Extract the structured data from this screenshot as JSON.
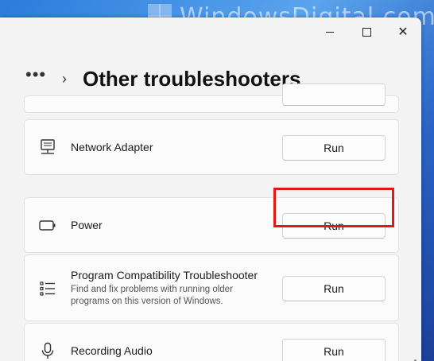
{
  "watermark": {
    "text": "WindowsDigital.com"
  },
  "window": {
    "caption": {
      "minimize_icon": "minimize-icon",
      "maximize_icon": "maximize-icon",
      "close_icon": "close-icon",
      "close_glyph": "✕"
    }
  },
  "header": {
    "more_glyph": "•••",
    "chevron_glyph": "›",
    "title": "Other troubleshooters"
  },
  "items": [
    {
      "title": "Network Adapter",
      "description": "",
      "icon": "network-icon",
      "run_label": "Run"
    },
    {
      "title": "Power",
      "description": "",
      "icon": "battery-icon",
      "run_label": "Run"
    },
    {
      "title": "Program Compatibility Troubleshooter",
      "description": "Find and fix problems with running older programs on this version of Windows.",
      "icon": "list-icon",
      "run_label": "Run"
    },
    {
      "title": "Recording Audio",
      "description": "",
      "icon": "microphone-icon",
      "run_label": "Run"
    }
  ],
  "highlight": {
    "target": "Power Run button",
    "color": "#e01717"
  }
}
